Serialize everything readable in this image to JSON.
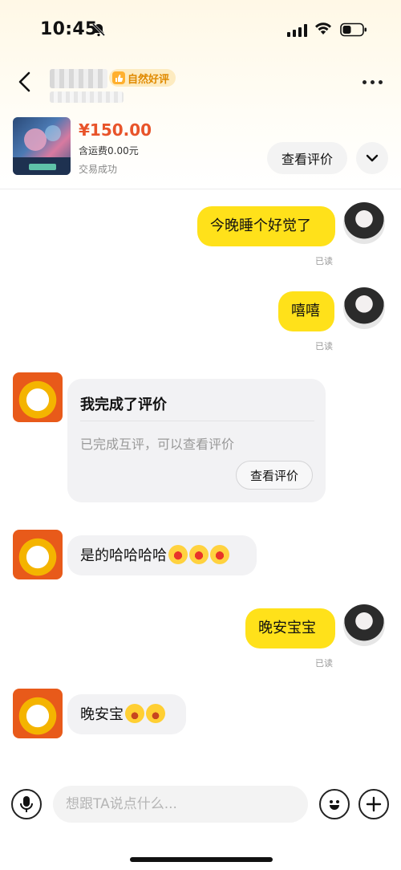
{
  "status_bar": {
    "time": "10:45"
  },
  "header": {
    "contact_name": "▪ ▪▪ ▪",
    "contact_sub": "▪▪▪▪▪",
    "rating_badge": "自然好评"
  },
  "product": {
    "price": "¥150.00",
    "shipping": "含运费0.00元",
    "status": "交易成功",
    "view_review_label": "查看评价"
  },
  "messages": [
    {
      "side": "mine",
      "text": "今晚睡个好觉了",
      "read": "已读"
    },
    {
      "side": "mine",
      "text": "嘻嘻",
      "read": "已读"
    },
    {
      "side": "theirs",
      "type": "card",
      "title": "我完成了评价",
      "desc": "已完成互评，可以查看评价",
      "button": "查看评价"
    },
    {
      "side": "theirs",
      "text": "是的哈哈哈哈",
      "emoji": [
        "smile-heart-eyes-icon",
        "smile-heart-eyes-icon",
        "smile-heart-eyes-icon"
      ]
    },
    {
      "side": "mine",
      "text": "晚安宝宝",
      "read": "已读"
    },
    {
      "side": "theirs",
      "text": "晚安宝",
      "emoji": [
        "laughing-icon",
        "laughing-icon"
      ]
    }
  ],
  "input_bar": {
    "placeholder": "想跟TA说点什么..."
  },
  "colors": {
    "accent_yellow": "#ffe11a",
    "price_red": "#e8542a",
    "badge_orange": "#e08a00"
  }
}
